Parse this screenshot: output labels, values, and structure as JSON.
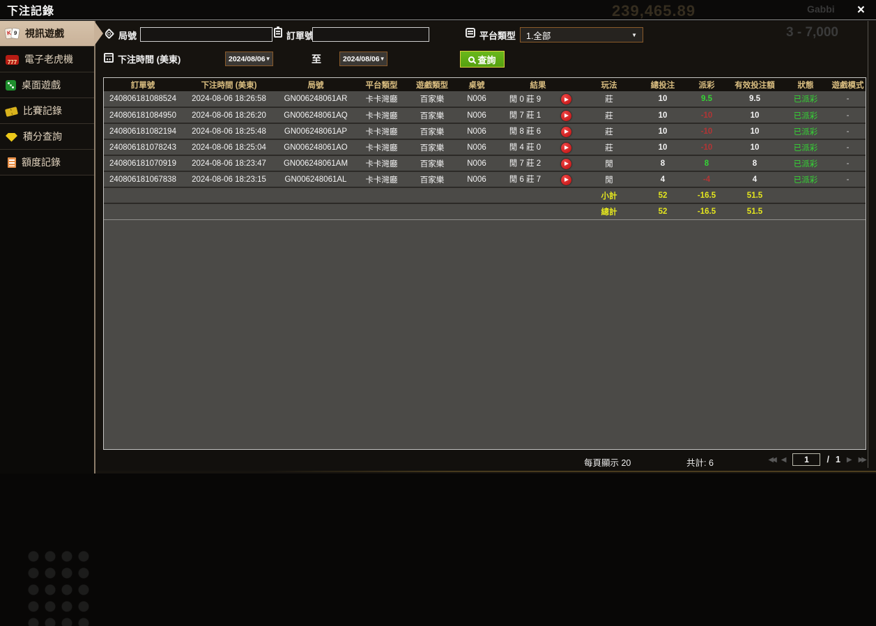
{
  "window": {
    "title": "下注記錄",
    "close_glyph": "×"
  },
  "background_hints": {
    "balance": "239,465.89",
    "player": "Gabbi",
    "range": "3 - 7,000"
  },
  "colors": {
    "accent_tan": "#c9b299",
    "header_text": "#d9bd80",
    "positive": "#35d435",
    "negative": "#b23535",
    "status_green": "#35d435",
    "summary_yellow": "#e4e61e",
    "button_green": "#55a010",
    "date_border": "#8a5a2a"
  },
  "sidebar": {
    "items": [
      {
        "id": "video-games",
        "label": "視訊遊戲",
        "icon": "playing-cards-icon",
        "active": true
      },
      {
        "id": "slot-machines",
        "label": "電子老虎機",
        "icon": "slot-777-icon",
        "active": false
      },
      {
        "id": "table-games",
        "label": "桌面遊戲",
        "icon": "dice-icon",
        "active": false
      },
      {
        "id": "match-records",
        "label": "比賽記錄",
        "icon": "ticket-icon",
        "active": false
      },
      {
        "id": "points-inquiry",
        "label": "積分查詢",
        "icon": "gem-icon",
        "active": false
      },
      {
        "id": "credit-records",
        "label": "額度記錄",
        "icon": "document-icon",
        "active": false
      }
    ]
  },
  "filters": {
    "round_label": "局號",
    "order_label": "訂單號",
    "platform_label": "平台類型",
    "platform_value": "1.全部",
    "time_label": "下注時間 (美東)",
    "date_from": "2024/08/06",
    "date_to": "2024/08/06",
    "to_label": "至",
    "search_label": "查詢",
    "caret_glyph": "▼"
  },
  "table": {
    "headers": [
      "訂單號",
      "下注時間 (美東)",
      "局號",
      "平台類型",
      "遊戲類型",
      "桌號",
      "結果",
      "玩法",
      "總投注",
      "派彩",
      "有效投注額",
      "狀態",
      "遊戲模式"
    ],
    "rows": [
      {
        "order": "240806181088524",
        "time": "2024-08-06 18:26:58",
        "round": "GN006248061AR",
        "platform": "卡卡灣廳",
        "game": "百家樂",
        "table_no": "N006",
        "result": "閒 0 莊 9",
        "bet": "莊",
        "total": "10",
        "payout": "9.5",
        "payout_sign": "positive",
        "valid": "9.5",
        "status": "已派彩",
        "mode": "-"
      },
      {
        "order": "240806181084950",
        "time": "2024-08-06 18:26:20",
        "round": "GN006248061AQ",
        "platform": "卡卡灣廳",
        "game": "百家樂",
        "table_no": "N006",
        "result": "閒 7 莊 1",
        "bet": "莊",
        "total": "10",
        "payout": "-10",
        "payout_sign": "negative",
        "valid": "10",
        "status": "已派彩",
        "mode": "-"
      },
      {
        "order": "240806181082194",
        "time": "2024-08-06 18:25:48",
        "round": "GN006248061AP",
        "platform": "卡卡灣廳",
        "game": "百家樂",
        "table_no": "N006",
        "result": "閒 8 莊 6",
        "bet": "莊",
        "total": "10",
        "payout": "-10",
        "payout_sign": "negative",
        "valid": "10",
        "status": "已派彩",
        "mode": "-"
      },
      {
        "order": "240806181078243",
        "time": "2024-08-06 18:25:04",
        "round": "GN006248061AO",
        "platform": "卡卡灣廳",
        "game": "百家樂",
        "table_no": "N006",
        "result": "閒 4 莊 0",
        "bet": "莊",
        "total": "10",
        "payout": "-10",
        "payout_sign": "negative",
        "valid": "10",
        "status": "已派彩",
        "mode": "-"
      },
      {
        "order": "240806181070919",
        "time": "2024-08-06 18:23:47",
        "round": "GN006248061AM",
        "platform": "卡卡灣廳",
        "game": "百家樂",
        "table_no": "N006",
        "result": "閒 7 莊 2",
        "bet": "閒",
        "total": "8",
        "payout": "8",
        "payout_sign": "positive",
        "valid": "8",
        "status": "已派彩",
        "mode": "-"
      },
      {
        "order": "240806181067838",
        "time": "2024-08-06 18:23:15",
        "round": "GN006248061AL",
        "platform": "卡卡灣廳",
        "game": "百家樂",
        "table_no": "N006",
        "result": "閒 6 莊 7",
        "bet": "閒",
        "total": "4",
        "payout": "-4",
        "payout_sign": "negative",
        "valid": "4",
        "status": "已派彩",
        "mode": "-"
      }
    ],
    "subtotal": {
      "label": "小計",
      "total": "52",
      "payout": "-16.5",
      "valid": "51.5"
    },
    "grand_total": {
      "label": "總計",
      "total": "52",
      "payout": "-16.5",
      "valid": "51.5"
    }
  },
  "pagination": {
    "per_page_label": "每頁顯示 20",
    "total_label": "共計: 6",
    "page": "1",
    "separator": "/",
    "page_total": "1"
  }
}
